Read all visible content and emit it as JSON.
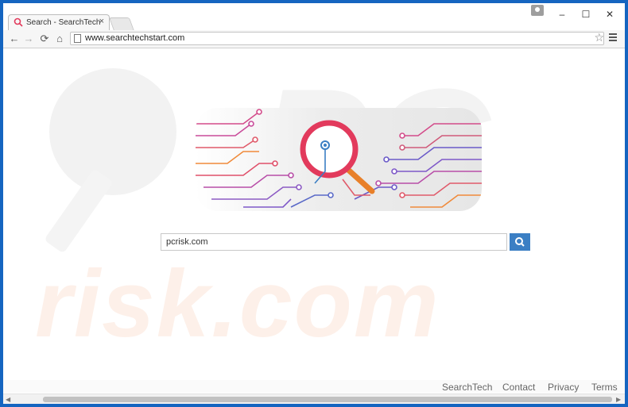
{
  "tab": {
    "title": "Search - SearchTech",
    "close": "×"
  },
  "window_controls": {
    "minimize": "–",
    "maximize": "☐",
    "close": "✕"
  },
  "toolbar": {
    "back": "←",
    "forward": "→",
    "reload": "⟳",
    "home": "⌂",
    "star": "☆"
  },
  "omnibox": {
    "url": "www.searchtechstart.com"
  },
  "search": {
    "value": "pcrisk.com"
  },
  "footer": {
    "links": [
      "SearchTech",
      "Contact",
      "Privacy",
      "Terms"
    ]
  },
  "watermark": {
    "text": "risk.com"
  },
  "colors": {
    "accent": "#3b7fc4",
    "logo_ring": "#e23a5c",
    "frame": "#1565c0"
  },
  "icons": [
    "search-icon",
    "magnifier-logo-icon",
    "star-icon",
    "menu-icon"
  ]
}
